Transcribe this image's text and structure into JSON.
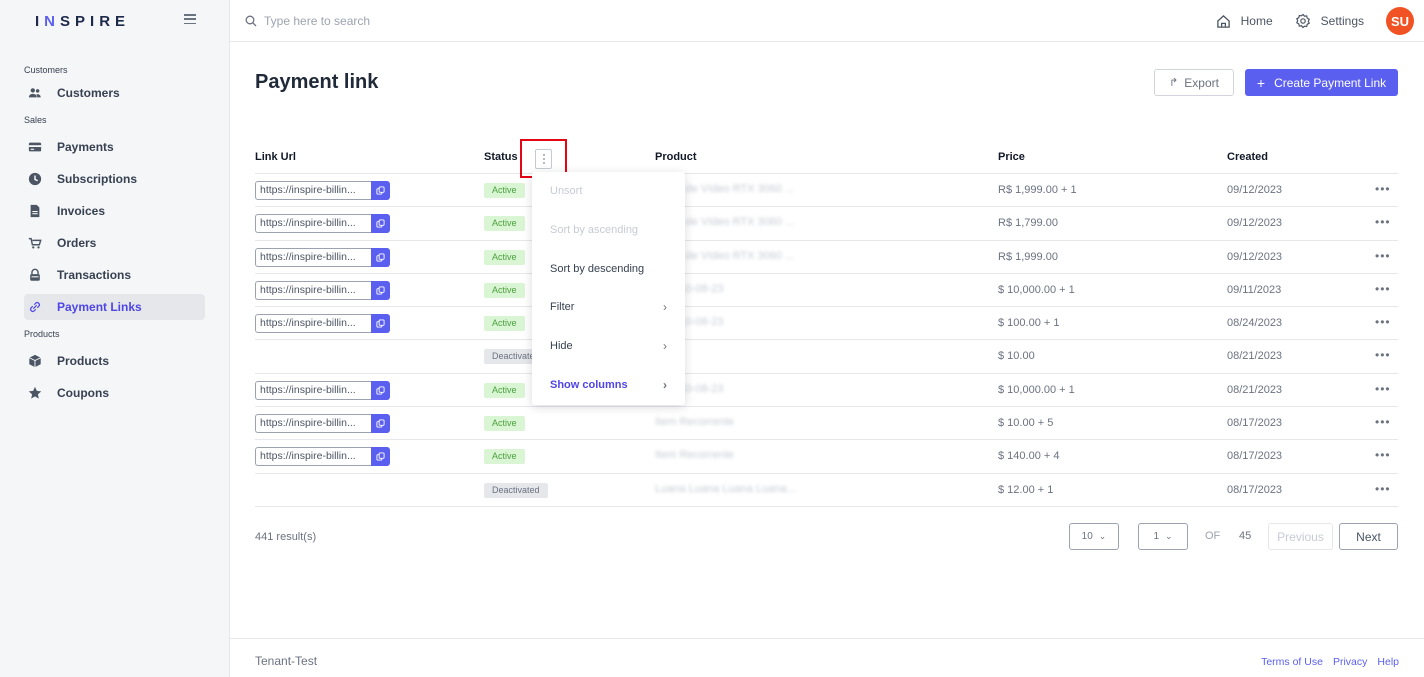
{
  "app": {
    "logo_pre": "I",
    "logo_accent": "N",
    "logo_post": "SPIRE"
  },
  "sidebar": {
    "sections": [
      {
        "label": "Customers",
        "items": [
          {
            "label": "Customers",
            "icon": "users-icon"
          }
        ]
      },
      {
        "label": "Sales",
        "items": [
          {
            "label": "Payments",
            "icon": "credit-card-icon"
          },
          {
            "label": "Subscriptions",
            "icon": "clock-icon"
          },
          {
            "label": "Invoices",
            "icon": "document-icon"
          },
          {
            "label": "Orders",
            "icon": "cart-icon"
          },
          {
            "label": "Transactions",
            "icon": "lock-icon"
          },
          {
            "label": "Payment Links",
            "icon": "link-icon",
            "active": true
          }
        ]
      },
      {
        "label": "Products",
        "items": [
          {
            "label": "Products",
            "icon": "box-icon"
          },
          {
            "label": "Coupons",
            "icon": "star-icon"
          }
        ]
      }
    ]
  },
  "topbar": {
    "search_placeholder": "Type here to search",
    "home_label": "Home",
    "settings_label": "Settings",
    "avatar_initials": "SU"
  },
  "page": {
    "title": "Payment link",
    "export_label": "Export",
    "create_label": "Create Payment Link"
  },
  "table": {
    "headers": {
      "url": "Link Url",
      "status": "Status",
      "product": "Product",
      "price": "Price",
      "created": "Created"
    },
    "rows": [
      {
        "url": "https://inspire-billin...",
        "status": "Active",
        "product": "Placa de Vídeo RTX 3060 ...",
        "price": "R$ 1,999.00 + 1",
        "created": "09/12/2023"
      },
      {
        "url": "https://inspire-billin...",
        "status": "Active",
        "product": "Placa de Vídeo RTX 3060 ...",
        "price": "R$ 1,799.00",
        "created": "09/12/2023"
      },
      {
        "url": "https://inspire-billin...",
        "status": "Active",
        "product": "Placa de Vídeo RTX 3060 ...",
        "price": "R$ 1,999.00",
        "created": "09/12/2023"
      },
      {
        "url": "https://inspire-billin...",
        "status": "Active",
        "product": "Item 10-08-23",
        "price": "$ 10,000.00 + 1",
        "created": "09/11/2023"
      },
      {
        "url": "https://inspire-billin...",
        "status": "Active",
        "product": "Item 10-08-23",
        "price": "$ 100.00 + 1",
        "created": "08/24/2023"
      },
      {
        "url": "",
        "status": "Deactivated",
        "product": "",
        "price": "$ 10.00",
        "created": "08/21/2023"
      },
      {
        "url": "https://inspire-billin...",
        "status": "Active",
        "product": "Item 10-08-23",
        "price": "$ 10,000.00 + 1",
        "created": "08/21/2023"
      },
      {
        "url": "https://inspire-billin...",
        "status": "Active",
        "product": "Item Recorrente",
        "price": "$ 10.00 + 5",
        "created": "08/17/2023"
      },
      {
        "url": "https://inspire-billin...",
        "status": "Active",
        "product": "Item Recorrente",
        "price": "$ 140.00 + 4",
        "created": "08/17/2023"
      },
      {
        "url": "",
        "status": "Deactivated",
        "product": "Luana Luana Luana Luana...",
        "price": "$ 12.00 + 1",
        "created": "08/17/2023"
      }
    ],
    "row_actions": "•••"
  },
  "column_menu": {
    "items": [
      {
        "label": "Unsort",
        "disabled": true
      },
      {
        "label": "Sort by ascending",
        "disabled": true
      },
      {
        "label": "Sort by descending"
      },
      {
        "label": "Filter",
        "submenu": true
      },
      {
        "label": "Hide",
        "submenu": true
      },
      {
        "label": "Show columns",
        "submenu": true,
        "bold": true
      }
    ]
  },
  "pagination": {
    "results": "441 result(s)",
    "page_size": "10",
    "page": "1",
    "of_label": "OF",
    "total_pages": "45",
    "prev_label": "Previous",
    "next_label": "Next"
  },
  "footer": {
    "tenant": "Tenant-Test",
    "links": [
      "Terms of Use",
      "Privacy",
      "Help"
    ]
  },
  "colors": {
    "accent": "#5b5fef",
    "avatar": "#f05223",
    "highlight": "#e30613"
  }
}
